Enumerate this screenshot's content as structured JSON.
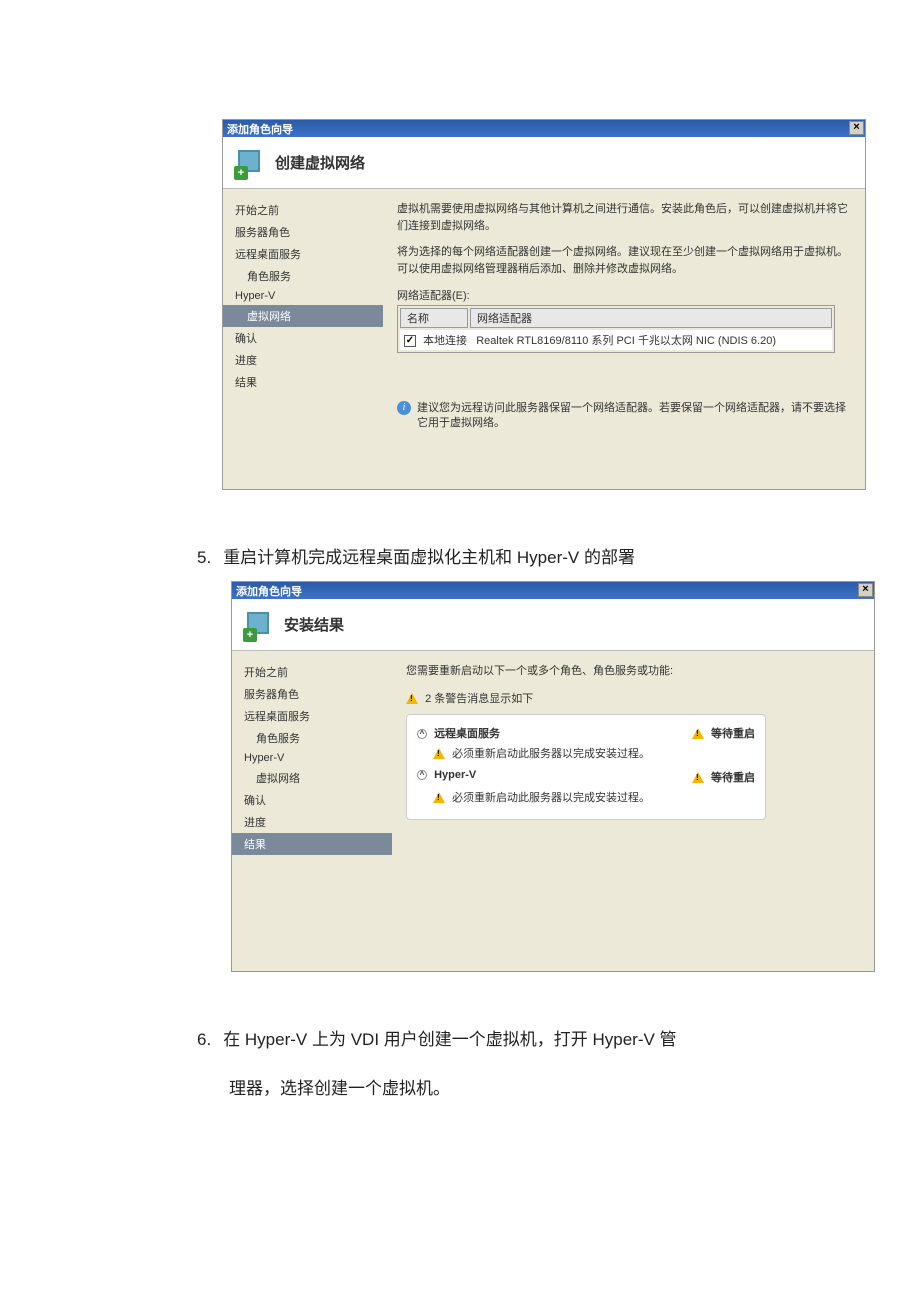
{
  "wizard1": {
    "title": "添加角色向导",
    "header": "创建虚拟网络",
    "sidebar": [
      "开始之前",
      "服务器角色",
      "远程桌面服务",
      "角色服务",
      "Hyper-V",
      "虚拟网络",
      "确认",
      "进度",
      "结果"
    ],
    "content": {
      "p1": "虚拟机需要使用虚拟网络与其他计算机之间进行通信。安装此角色后，可以创建虚拟机并将它们连接到虚拟网络。",
      "p2": "将为选择的每个网络适配器创建一个虚拟网络。建议现在至少创建一个虚拟网络用于虚拟机。可以使用虚拟网络管理器稍后添加、删除并修改虚拟网络。",
      "adapterLabel": "网络适配器(E):",
      "table": {
        "col1": "名称",
        "col2": "网络适配器",
        "rowName": "本地连接",
        "rowAdapter": "Realtek RTL8169/8110 系列 PCI 千兆以太网 NIC (NDIS 6.20)"
      },
      "note": "建议您为远程访问此服务器保留一个网络适配器。若要保留一个网络适配器，请不要选择它用于虚拟网络。"
    }
  },
  "caption5": {
    "num": "5.",
    "text": "重启计算机完成远程桌面虚拟化主机和 Hyper-V 的部署"
  },
  "wizard2": {
    "title": "添加角色向导",
    "header": "安装结果",
    "sidebar": [
      "开始之前",
      "服务器角色",
      "远程桌面服务",
      "角色服务",
      "Hyper-V",
      "虚拟网络",
      "确认",
      "进度",
      "结果"
    ],
    "content": {
      "intro": "您需要重新启动以下一个或多个角色、角色服务或功能:",
      "warnMsg": "2 条警告消息显示如下",
      "service1": {
        "name": "远程桌面服务",
        "status": "等待重启",
        "msg": "必须重新启动此服务器以完成安装过程。"
      },
      "service2": {
        "name": "Hyper-V",
        "status": "等待重启",
        "msg": "必须重新启动此服务器以完成安装过程。"
      }
    }
  },
  "caption6": {
    "num": "6.",
    "text1": "在 Hyper-V 上为 VDI 用户创建一个虚拟机，打开 Hyper-V 管",
    "text2": "理器，选择创建一个虚拟机。"
  }
}
